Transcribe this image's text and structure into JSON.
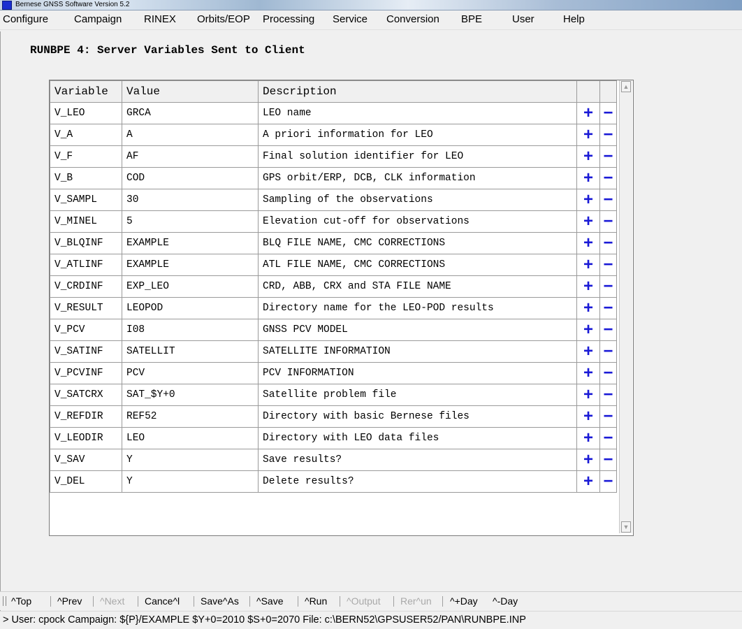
{
  "window": {
    "title": "Bernese GNSS Software Version 5.2"
  },
  "menu": [
    {
      "label": "Configure"
    },
    {
      "label": "Campaign"
    },
    {
      "label": "RINEX"
    },
    {
      "label": "Orbits/EOP"
    },
    {
      "label": "Processing"
    },
    {
      "label": "Service"
    },
    {
      "label": "Conversion"
    },
    {
      "label": "BPE"
    },
    {
      "label": "User"
    },
    {
      "label": "Help"
    }
  ],
  "page": {
    "title": "RUNBPE 4: Server Variables Sent to Client"
  },
  "table": {
    "headers": [
      "Variable",
      "Value",
      "Description"
    ],
    "plus_symbol": "+",
    "minus_symbol": "−",
    "rows": [
      {
        "variable": "V_LEO",
        "value": "GRCA",
        "description": "LEO name"
      },
      {
        "variable": "V_A",
        "value": "A",
        "description": "A priori information for LEO"
      },
      {
        "variable": "V_F",
        "value": "AF",
        "description": "Final solution identifier for LEO"
      },
      {
        "variable": "V_B",
        "value": "COD",
        "description": "GPS orbit/ERP, DCB, CLK information"
      },
      {
        "variable": "V_SAMPL",
        "value": "30",
        "description": "Sampling of the observations"
      },
      {
        "variable": "V_MINEL",
        "value": "5",
        "description": "Elevation cut-off for observations"
      },
      {
        "variable": "V_BLQINF",
        "value": "EXAMPLE",
        "description": "BLQ FILE NAME, CMC CORRECTIONS"
      },
      {
        "variable": "V_ATLINF",
        "value": "EXAMPLE",
        "description": "ATL FILE NAME, CMC CORRECTIONS"
      },
      {
        "variable": "V_CRDINF",
        "value": "EXP_LEO",
        "description": "CRD, ABB, CRX and STA FILE NAME"
      },
      {
        "variable": "V_RESULT",
        "value": "LEOPOD",
        "description": "Directory name for the LEO-POD results"
      },
      {
        "variable": "V_PCV",
        "value": "I08",
        "description": "GNSS PCV MODEL"
      },
      {
        "variable": "V_SATINF",
        "value": "SATELLIT",
        "description": "SATELLITE INFORMATION"
      },
      {
        "variable": "V_PCVINF",
        "value": "PCV",
        "description": "PCV INFORMATION"
      },
      {
        "variable": "V_SATCRX",
        "value": "SAT_$Y+0",
        "description": "Satellite problem file"
      },
      {
        "variable": "V_REFDIR",
        "value": "REF52",
        "description": "Directory with basic Bernese files"
      },
      {
        "variable": "V_LEODIR",
        "value": "LEO",
        "description": "Directory with LEO data files"
      },
      {
        "variable": "V_SAV",
        "value": "Y",
        "description": "Save results?"
      },
      {
        "variable": "V_DEL",
        "value": "Y",
        "description": "Delete results?"
      }
    ]
  },
  "toolbar": [
    {
      "label": "^Top",
      "enabled": true
    },
    {
      "label": "^Prev",
      "enabled": true
    },
    {
      "label": "^Next",
      "enabled": false
    },
    {
      "label": "Cance^l",
      "enabled": true
    },
    {
      "label": "Save^As",
      "enabled": true
    },
    {
      "label": "^Save",
      "enabled": true
    },
    {
      "label": "^Run",
      "enabled": true
    },
    {
      "label": "^Output",
      "enabled": false
    },
    {
      "label": "Rer^un",
      "enabled": false
    },
    {
      "label": "^+Day",
      "enabled": true
    },
    {
      "label": "^-Day",
      "enabled": true
    }
  ],
  "status": {
    "text": "> User: cpock  Campaign: ${P}/EXAMPLE  $Y+0=2010  $S+0=2070  File: c:\\BERN52\\GPSUSER52/PAN\\RUNBPE.INP"
  },
  "colors": {
    "accent": "#1a1ad6",
    "app_icon": "#1b2fd0"
  }
}
